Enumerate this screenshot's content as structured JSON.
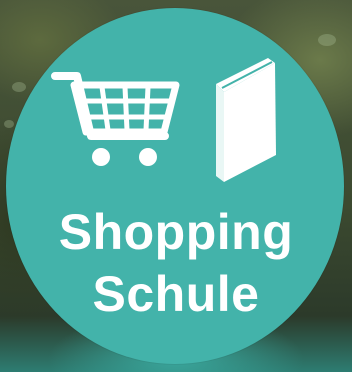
{
  "badge": {
    "line1": "Shopping",
    "line2": "Schule",
    "colors": {
      "circle": "#43b3aa",
      "text": "#ffffff",
      "icon": "#ffffff"
    },
    "icons": [
      "shopping-cart-icon",
      "book-icon"
    ]
  }
}
